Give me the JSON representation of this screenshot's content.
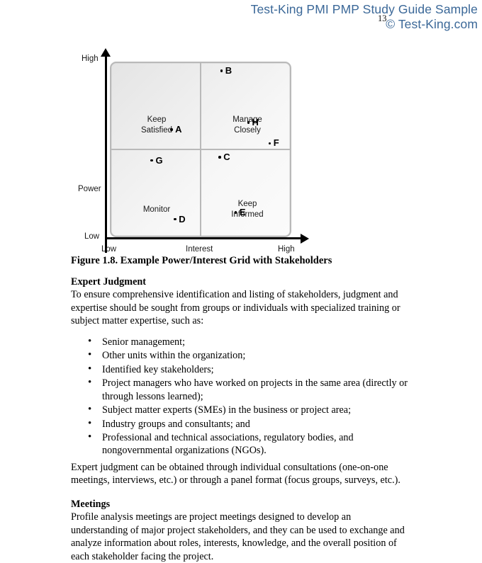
{
  "header": {
    "title": "Test-King PMI PMP Study Guide Sample",
    "copyright": "© Test-King.com",
    "page_number": "13"
  },
  "chart_data": {
    "type": "scatter",
    "title": "Example Power/Interest Grid with Stakeholders",
    "xlabel": "Interest",
    "ylabel": "Power",
    "x_ticks": [
      "Low",
      "Interest",
      "High"
    ],
    "y_ticks": [
      "High",
      "Low"
    ],
    "xlim": [
      "Low",
      "High"
    ],
    "ylim": [
      "Low",
      "High"
    ],
    "grid": true,
    "legend": "none",
    "quadrants": [
      {
        "id": "keep-satisfied",
        "label": "Keep\nSatisfied",
        "power": "High",
        "interest": "Low"
      },
      {
        "id": "manage-closely",
        "label": "Manage\nClosely",
        "power": "High",
        "interest": "High"
      },
      {
        "id": "monitor",
        "label": "Monitor",
        "power": "Low",
        "interest": "Low"
      },
      {
        "id": "keep-informed",
        "label": "Keep\nInformed",
        "power": "Low",
        "interest": "High"
      }
    ],
    "points": [
      {
        "label": "A",
        "quadrant": "keep-satisfied",
        "x": 0.33,
        "y": 0.62
      },
      {
        "label": "B",
        "quadrant": "manage-closely",
        "x": 0.61,
        "y": 0.96
      },
      {
        "label": "C",
        "quadrant": "keep-informed",
        "x": 0.6,
        "y": 0.46
      },
      {
        "label": "D",
        "quadrant": "monitor",
        "x": 0.35,
        "y": 0.1
      },
      {
        "label": "E",
        "quadrant": "keep-informed",
        "x": 0.69,
        "y": 0.14
      },
      {
        "label": "F",
        "quadrant": "manage-closely",
        "x": 0.88,
        "y": 0.54
      },
      {
        "label": "G",
        "quadrant": "monitor",
        "x": 0.22,
        "y": 0.44
      },
      {
        "label": "H",
        "quadrant": "manage-closely",
        "x": 0.76,
        "y": 0.66
      }
    ]
  },
  "figure": {
    "caption": "Figure 1.8. Example Power/Interest Grid with Stakeholders"
  },
  "content": {
    "expert_judgment_heading": "Expert Judgment",
    "expert_judgment_intro": "To ensure comprehensive identification and listing of stakeholders, judgment and expertise should be sought from groups or individuals with specialized training or subject matter expertise, such as:",
    "bullets": [
      "Senior management;",
      "Other units within the organization;",
      "Identified key stakeholders;",
      "Project managers who have worked on projects in the same area (directly or through lessons learned);",
      "Subject matter experts (SMEs) in the business or project area;",
      "Industry groups and consultants; and",
      "Professional and technical associations, regulatory bodies, and nongovernmental organizations (NGOs)."
    ],
    "expert_judgment_outro": "Expert judgment can be obtained through individual consultations (one-on-one meetings, interviews, etc.) or through a panel format (focus groups, surveys, etc.).",
    "meetings_heading": "Meetings",
    "meetings_body": "Profile analysis meetings are project meetings designed to develop an understanding of major project stakeholders, and they can be used to exchange and analyze information about roles, interests, knowledge, and the overall position of each stakeholder facing the project."
  }
}
